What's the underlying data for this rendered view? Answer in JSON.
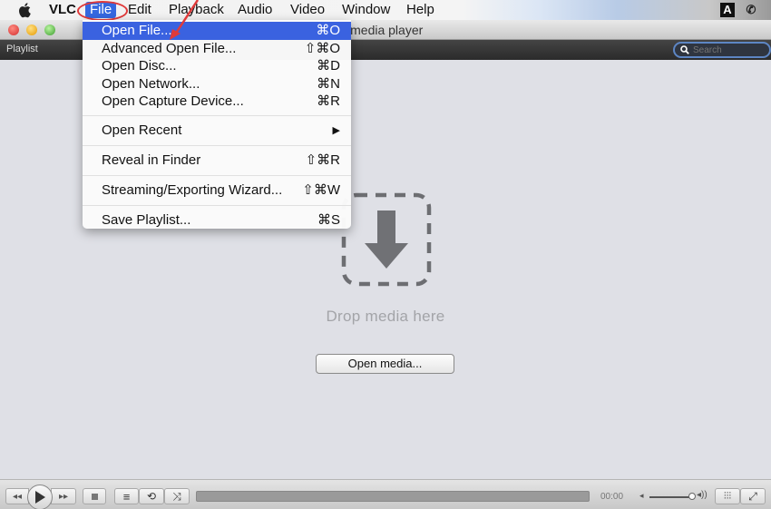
{
  "menubar": {
    "app_name": "VLC",
    "items": [
      "File",
      "Edit",
      "Playback",
      "Audio",
      "Video",
      "Window",
      "Help"
    ],
    "active_item": "File",
    "status_icons": [
      "adobe-icon",
      "phone-icon"
    ]
  },
  "window": {
    "title": "VLC media player",
    "title_visible": "C media player"
  },
  "playlist_bar": {
    "label": "Playlist",
    "search_placeholder": "Search"
  },
  "file_menu": {
    "items": [
      {
        "label": "Open File...",
        "shortcut": "⌘O",
        "highlighted": true
      },
      {
        "label": "Advanced Open File...",
        "shortcut": "⇧⌘O"
      },
      {
        "label": "Open Disc...",
        "shortcut": "⌘D"
      },
      {
        "label": "Open Network...",
        "shortcut": "⌘N"
      },
      {
        "label": "Open Capture Device...",
        "shortcut": "⌘R"
      },
      {
        "label": "Open Recent",
        "shortcut": "▶"
      },
      {
        "label": "Reveal in Finder",
        "shortcut": "⇧⌘R"
      },
      {
        "label": "Streaming/Exporting Wizard...",
        "shortcut": "⇧⌘W"
      },
      {
        "label": "Save Playlist...",
        "shortcut": "⌘S"
      }
    ]
  },
  "main": {
    "drop_text": "Drop media here",
    "open_media_label": "Open media..."
  },
  "controls": {
    "time": "00:00",
    "progress": 0,
    "volume_fraction": 0.9
  },
  "annotation": {
    "color": "#e03a3a"
  }
}
